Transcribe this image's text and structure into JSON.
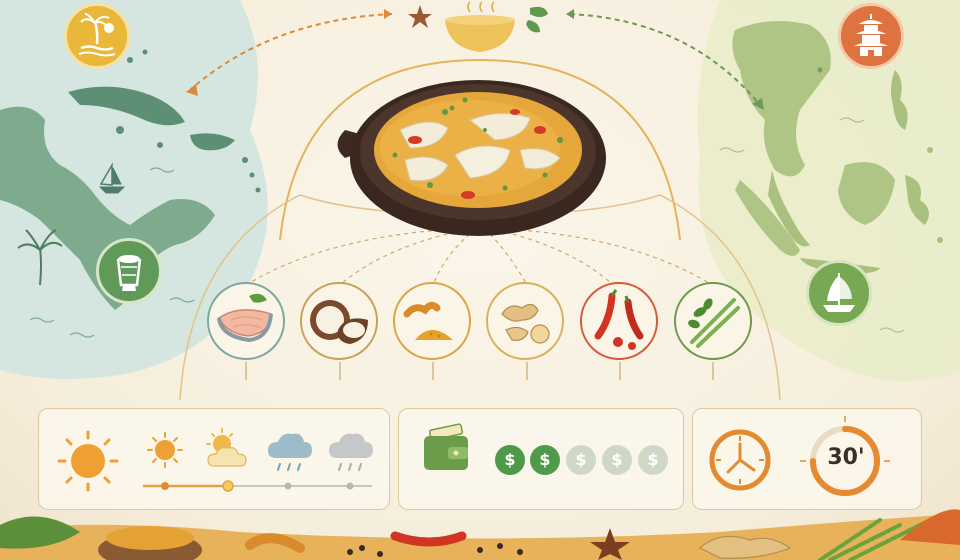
{
  "colors": {
    "background": "#f6eedc",
    "curry": "#e8a93a",
    "sun": "#eea033",
    "green": "#5d9a4c",
    "coin_active": "#4e9a4a",
    "coin_inactive": "#cfd8c7",
    "clock": "#e58a30",
    "caribbean_map": "#5c9a78",
    "asia_map": "#a7bf7c"
  },
  "regions": [
    {
      "name": "caribbean",
      "icons": [
        "palm-tree-badge-icon",
        "drum-badge-icon"
      ]
    },
    {
      "name": "southeast-asia",
      "icons": [
        "pagoda-badge-icon",
        "junk-boat-badge-icon"
      ]
    }
  ],
  "ingredients": [
    {
      "icon": "fish-fillet-icon"
    },
    {
      "icon": "coconut-icon"
    },
    {
      "icon": "turmeric-icon"
    },
    {
      "icon": "ginger-icon"
    },
    {
      "icon": "chili-icon"
    },
    {
      "icon": "herbs-icon"
    }
  ],
  "weather_panel": {
    "icons": [
      "sun-icon",
      "sun-icon",
      "partly-sunny-icon",
      "rain-cloud-icon",
      "rain-cloud-icon"
    ],
    "selected_index": 1
  },
  "cost_panel": {
    "symbol": "$",
    "coins": [
      "$",
      "$",
      "$",
      "$",
      "$"
    ],
    "active_count": 2
  },
  "time_panel": {
    "label": "30'"
  }
}
